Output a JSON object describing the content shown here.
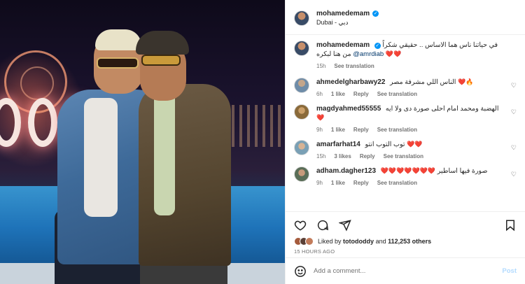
{
  "post": {
    "author": {
      "username": "mohamedemam",
      "location": "Dubai - دبي"
    },
    "caption": {
      "username": "mohamedemam",
      "text": "في حياتنا ناس هما الاساس .. حقيقي شكراً من هنا لبكره",
      "mention": "@amrdiab",
      "hearts": "❤️❤️",
      "time": "15h",
      "see_translation": "See translation"
    },
    "comments": [
      {
        "username": "ahmedelgharbawy22",
        "text": "الناس اللي مشرفة مصر",
        "emoji": "❤️🔥",
        "time": "6h",
        "likes": "1 like",
        "reply": "Reply",
        "see_translation": "See translation"
      },
      {
        "username": "magdyahmed55555",
        "text": "الهضبة ومحمد امام احلى صورة دى ولا ايه",
        "emoji": "❤️",
        "time": "9h",
        "likes": "1 like",
        "reply": "Reply",
        "see_translation": "See translation"
      },
      {
        "username": "amarfarhat14",
        "text": "توب التوب انتو",
        "emoji": "❤️❤️",
        "time": "15h",
        "likes": "3 likes",
        "reply": "Reply",
        "see_translation": "See translation"
      },
      {
        "username": "adham.dagher123",
        "text": "صورة فيها اساطير",
        "emoji": "❤️❤️❤️❤️❤️❤️❤️",
        "time": "9h",
        "likes": "1 like",
        "reply": "Reply",
        "see_translation": "See translation"
      }
    ],
    "likes": {
      "liked_by_prefix": "Liked by",
      "liked_by_user": "totododdy",
      "and_word": "and",
      "others": "112,253 others"
    },
    "posted_ago": "15 hours ago",
    "add_comment": {
      "placeholder": "Add a comment...",
      "post_label": "Post"
    },
    "icons": {
      "like": "heart-outline-icon",
      "comment": "comment-bubble-icon",
      "share": "paper-plane-icon",
      "save": "bookmark-icon",
      "emoji": "smiley-icon",
      "verified": "verified-badge-icon"
    },
    "colors": {
      "verified": "#0095f6",
      "heart": "#ed4956",
      "link": "#00376b",
      "secondary_text": "#737373"
    }
  }
}
